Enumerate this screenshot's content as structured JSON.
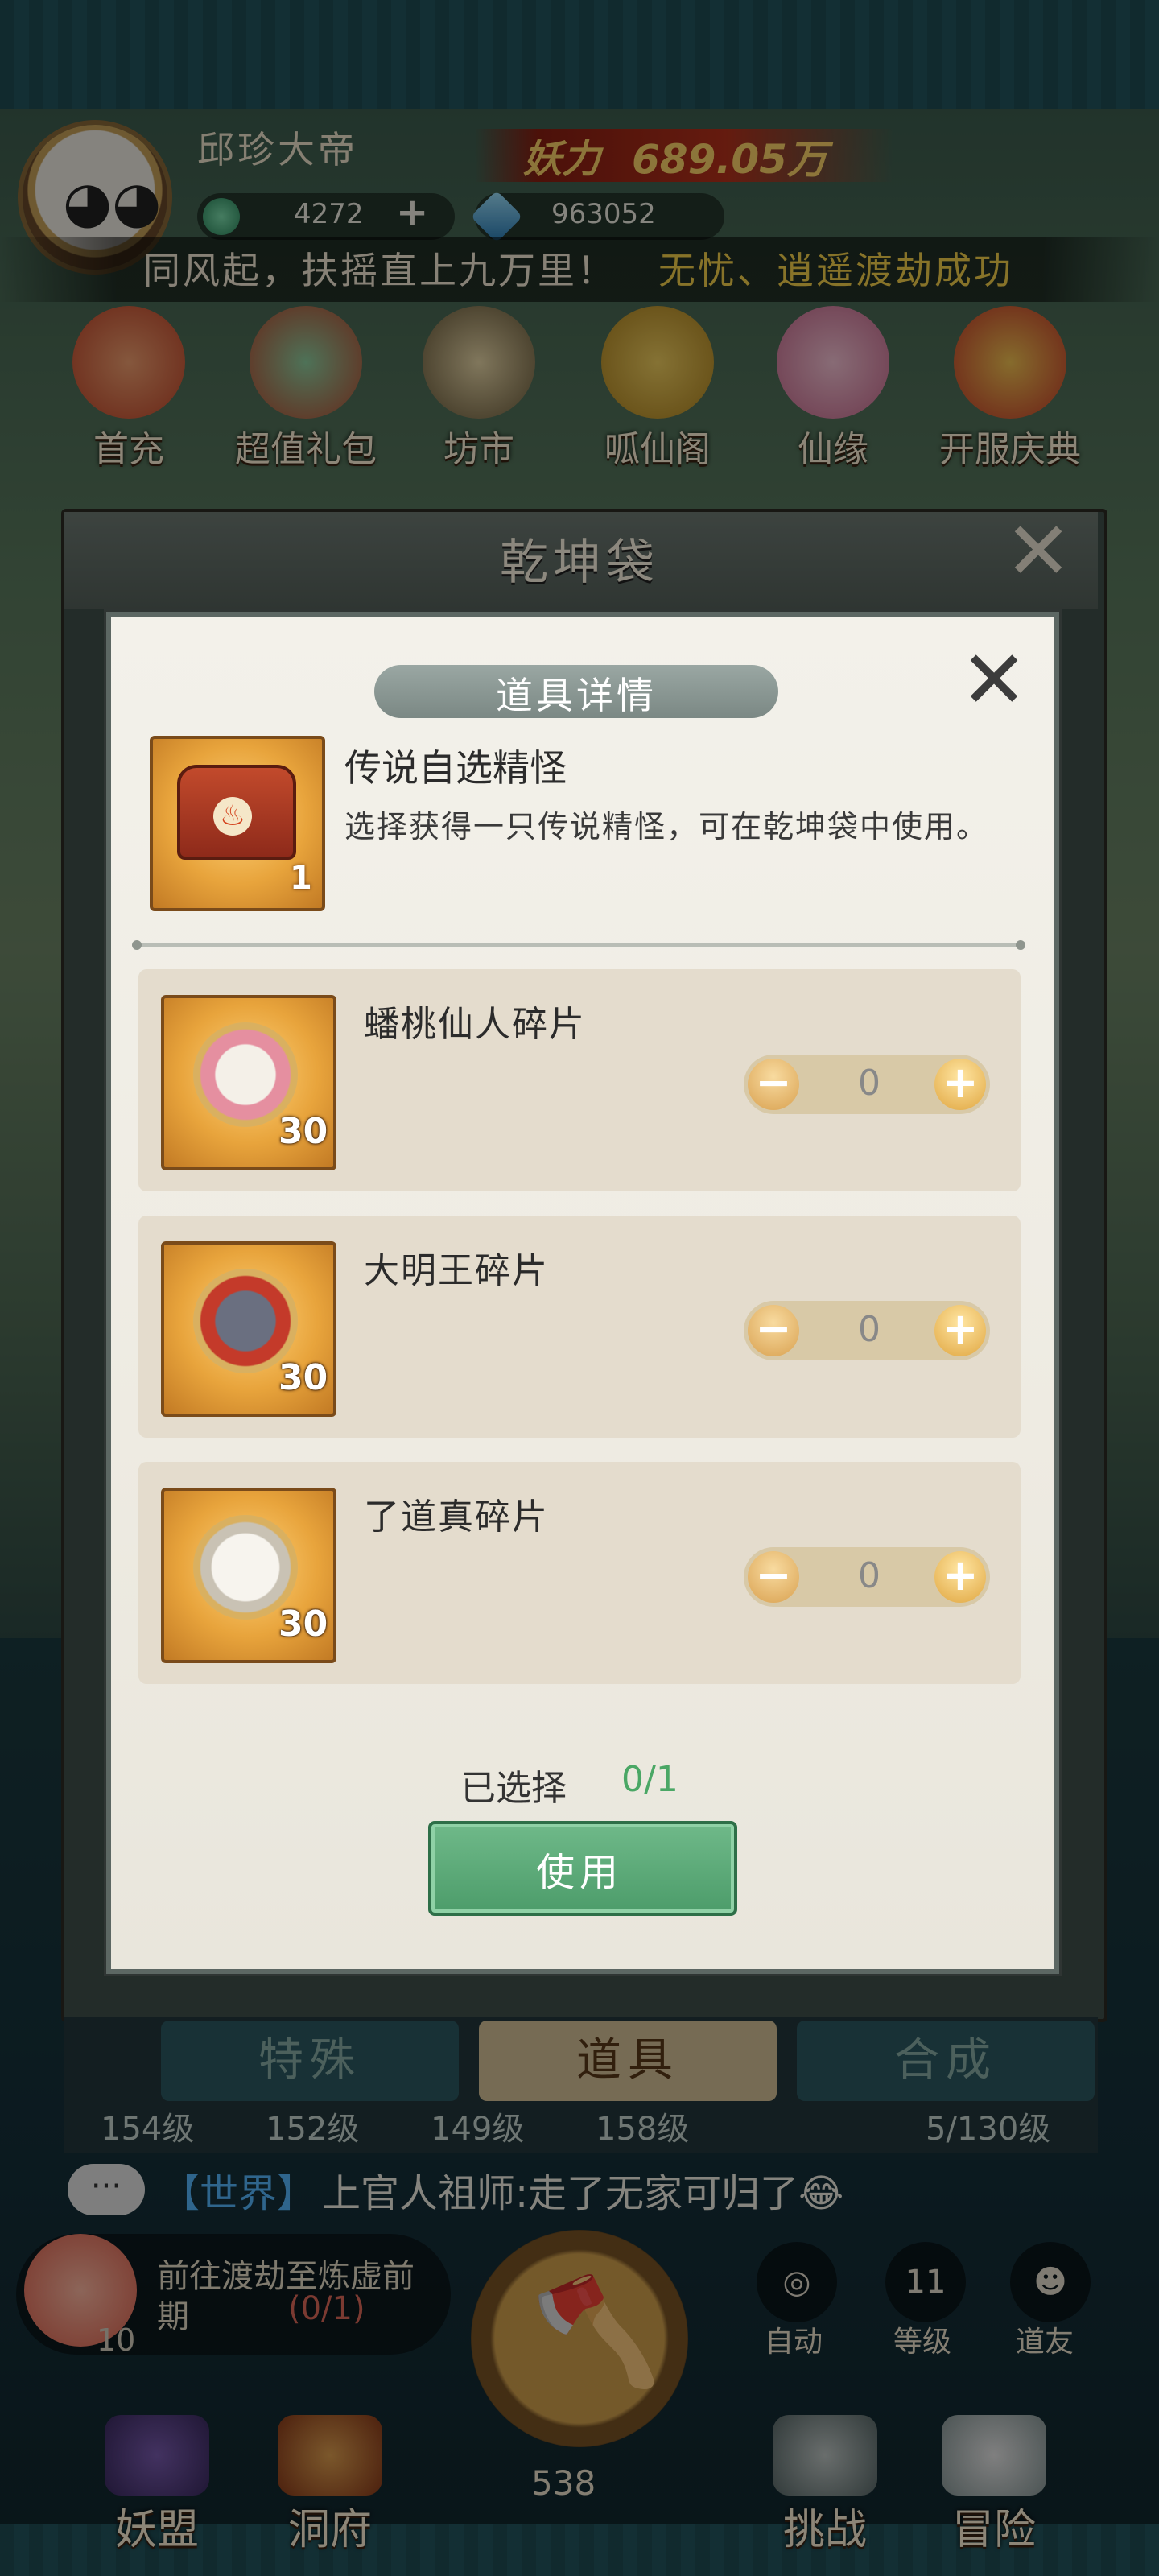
{
  "hud": {
    "player_name": "邱珍大帝",
    "power_label": "妖力",
    "power_value": "689.05万",
    "jade": "4272",
    "jade_plus": "+",
    "crystal": "963052",
    "ticker_text": "同风起，扶摇直上九万里！",
    "ticker_highlight": "无忧、逍遥渡劫成功"
  },
  "top_menu": [
    "首充",
    "超值礼包",
    "坊市",
    "呱仙阁",
    "仙缘",
    "开服庆典"
  ],
  "bag": {
    "title": "乾坤袋",
    "close_icon": "close-x",
    "tabs": [
      "特殊",
      "道具",
      "合成"
    ],
    "active_tab": "道具",
    "levels": [
      "154级",
      "152级",
      "149级",
      "158级"
    ],
    "misc_progress": "5/130级"
  },
  "dialog": {
    "title": "道具详情",
    "item": {
      "name": "传说自选精怪",
      "description": "选择获得一只传说精怪，可在乾坤袋中使用。",
      "quantity": "1"
    },
    "options": [
      {
        "name": "蟠桃仙人碎片",
        "count": "30",
        "value": "0"
      },
      {
        "name": "大明王碎片",
        "count": "30",
        "value": "0"
      },
      {
        "name": "了道真碎片",
        "count": "30",
        "value": "0"
      }
    ],
    "minus": "−",
    "plus": "+",
    "selected_label": "已选择",
    "selected_value": "0/1",
    "use_button": "使用"
  },
  "chat": {
    "bubble": "···",
    "channel": "【世界】",
    "message": "上官人祖师:走了无家可归了😂"
  },
  "quest": {
    "line1": "前往渡劫至炼虚前",
    "line2": "期",
    "progress": "(0/1)",
    "count": "10"
  },
  "right_buttons": {
    "auto": "自动",
    "level_num": "11",
    "level": "等级",
    "friend": "道友"
  },
  "axe_count": "538",
  "bottom_nav": [
    "妖盟",
    "洞府",
    "挑战",
    "冒险"
  ],
  "colors": {
    "power": "#ffd66b",
    "highlight": "#f6d24b",
    "selected": "#4aa765",
    "use_button": "#5aa877"
  }
}
